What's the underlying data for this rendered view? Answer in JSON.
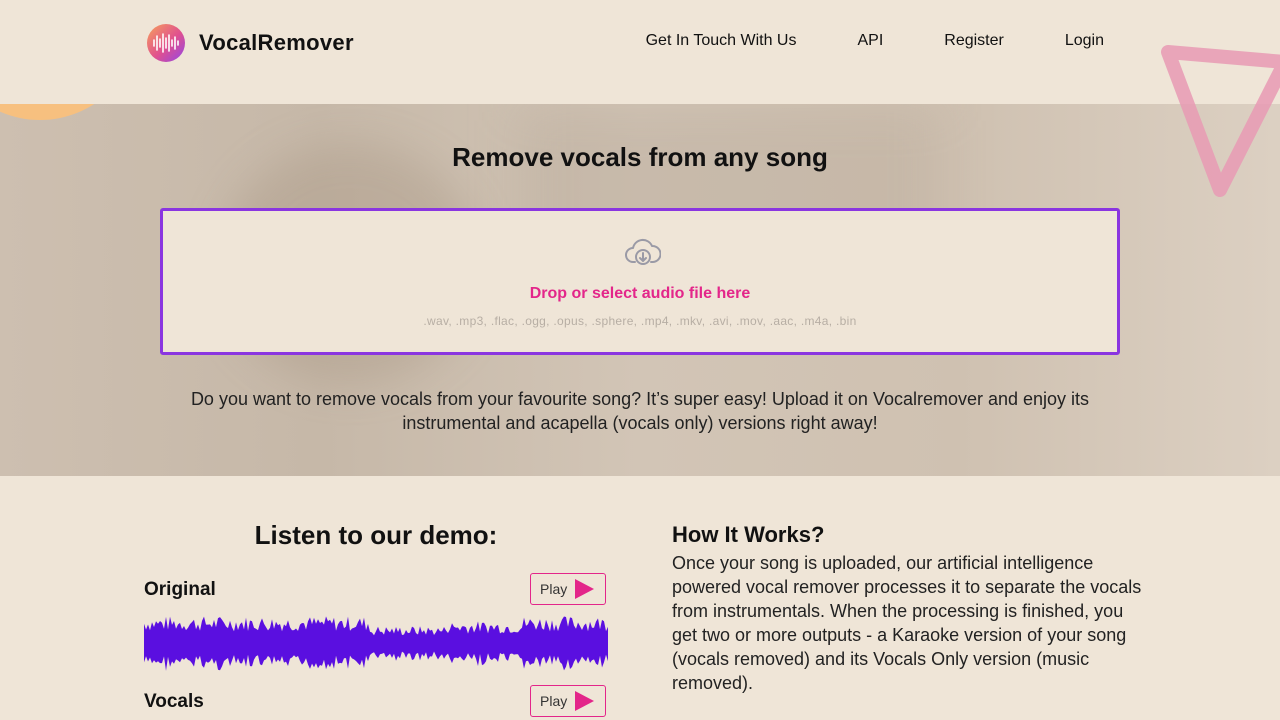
{
  "brand": {
    "name": "VocalRemover"
  },
  "nav": {
    "items": [
      {
        "label": "Get In Touch With Us"
      },
      {
        "label": "API"
      },
      {
        "label": "Register"
      },
      {
        "label": "Login"
      }
    ]
  },
  "hero": {
    "title": "Remove vocals from any song",
    "dropzone": {
      "icon": "cloud-download-icon",
      "label": "Drop or select audio file here",
      "formats": ".wav, .mp3, .flac, .ogg, .opus, .sphere, .mp4, .mkv, .avi, .mov, .aac, .m4a, .bin"
    },
    "intro": "Do you want to remove vocals from your favourite song? It’s super easy! Upload it on Vocalremover and enjoy its instrumental and acapella (vocals only) versions right away!"
  },
  "demo": {
    "title": "Listen to our demo:",
    "tracks": [
      {
        "label": "Original",
        "play_label": "Play"
      },
      {
        "label": "Vocals",
        "play_label": "Play"
      }
    ]
  },
  "how_it_works": {
    "title": "How It Works?",
    "body": "Once your song is uploaded, our artificial intelligence powered vocal remover processes it to separate the vocals from instrumentals. When the processing is finished, you get two or more outputs - a Karaoke version of your song (vocals removed) and its Vocals Only version (music removed)."
  },
  "colors": {
    "accent": "#e3268a",
    "dropzone_border": "#8a35e0",
    "waveform": "#5a0fe0",
    "background": "#efe5d7"
  }
}
